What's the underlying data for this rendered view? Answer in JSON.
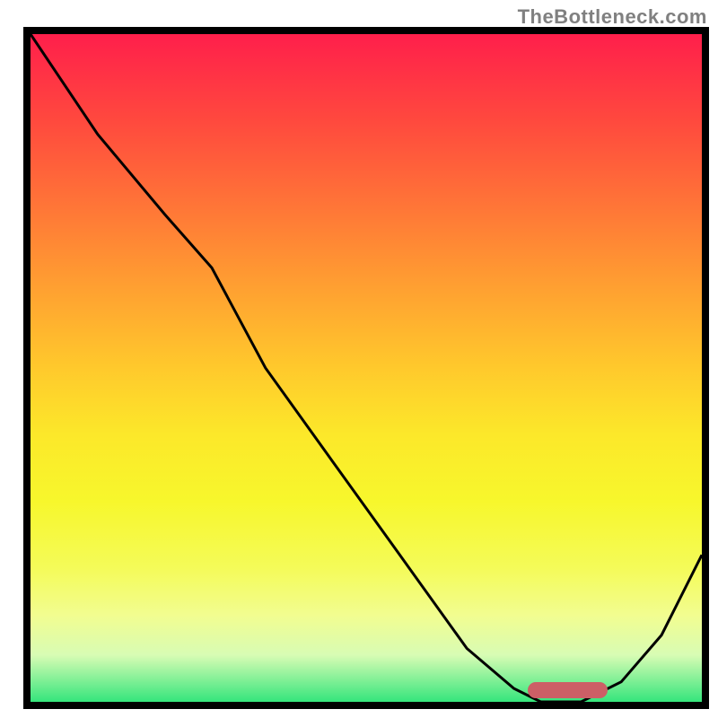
{
  "chart_data": {
    "type": "line",
    "x": [
      0,
      10,
      20,
      27,
      35,
      45,
      55,
      65,
      72,
      76,
      82,
      88,
      94,
      100
    ],
    "values": [
      100,
      85,
      73,
      65,
      50,
      36,
      22,
      8,
      2,
      0,
      0,
      3,
      10,
      22
    ],
    "title": "",
    "xlabel": "",
    "ylabel": "",
    "xlim": [
      0,
      100
    ],
    "ylim": [
      0,
      100
    ],
    "optimal_range": {
      "x_pct": [
        74,
        86
      ],
      "y_pct": 98.3
    }
  },
  "watermark": "TheBottleneck.com"
}
